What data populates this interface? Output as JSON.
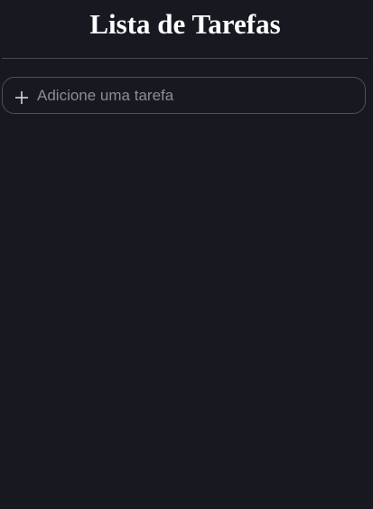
{
  "header": {
    "title": "Lista de Tarefas"
  },
  "add_task": {
    "icon": "plus-icon",
    "placeholder": "Adicione uma tarefa",
    "value": ""
  },
  "tasks": [],
  "colors": {
    "background": "#171820",
    "title": "#ffffff",
    "border": "#4e4f57",
    "placeholder": "#8d8e93"
  }
}
